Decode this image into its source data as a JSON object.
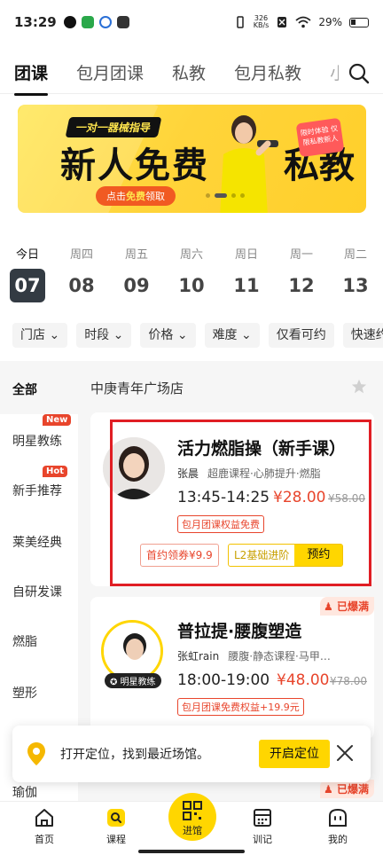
{
  "status": {
    "time": "13:29",
    "speed_top": "326",
    "speed_unit": "KB/s",
    "battery": "29%"
  },
  "tabs": [
    {
      "label": "团课"
    },
    {
      "label": "包月团课"
    },
    {
      "label": "私教"
    },
    {
      "label": "包月私教"
    },
    {
      "label": "小"
    }
  ],
  "banner": {
    "tag": "一对一器械指导",
    "headline_a": "新人免费",
    "headline_b": "私教",
    "cta_prefix": "点击",
    "cta_em": "免费",
    "cta_suffix": "领取",
    "badge": "限时体验 仅限私教新人"
  },
  "days": [
    {
      "name": "今日",
      "num": "07"
    },
    {
      "name": "周四",
      "num": "08"
    },
    {
      "name": "周五",
      "num": "09"
    },
    {
      "name": "周六",
      "num": "10"
    },
    {
      "name": "周日",
      "num": "11"
    },
    {
      "name": "周一",
      "num": "12"
    },
    {
      "name": "周二",
      "num": "13"
    }
  ],
  "filters": [
    "门店",
    "时段",
    "价格",
    "难度",
    "仅看可约",
    "快速约"
  ],
  "sidebar": [
    {
      "label": "全部"
    },
    {
      "label": "明星教练",
      "badge": "New"
    },
    {
      "label": "新手推荐",
      "badge": "Hot"
    },
    {
      "label": "莱美经典"
    },
    {
      "label": "自研发课"
    },
    {
      "label": "燃脂"
    },
    {
      "label": "塑形"
    },
    {
      "label": "瑜伽"
    }
  ],
  "store_name": "中庚青年广场店",
  "courses": [
    {
      "title": "活力燃脂操（新手课）",
      "coach": "张晨",
      "tags": "超鹿课程·心肺提升·燃脂",
      "time": "13:45-14:25",
      "price": "¥28.00",
      "orig_price": "¥58.00",
      "perk": "包月团课权益免费",
      "coupon": "首约领券¥9.9",
      "level": "L2基础进阶",
      "book": "预约"
    },
    {
      "title": "普拉提·腰腹塑造",
      "coach": "张虹rain",
      "tags": "腰腹·静态课程·马甲…",
      "time": "18:00-19:00",
      "price": "¥48.00",
      "orig_price": "¥78.00",
      "perk": "包月团课免费权益+19.9元",
      "full": "已爆满",
      "star_badge": "明星教练"
    }
  ],
  "next_full": "已爆满",
  "toast": {
    "message": "打开定位，找到最近场馆。",
    "button": "开启定位"
  },
  "nav": [
    {
      "label": "首页"
    },
    {
      "label": "课程"
    },
    {
      "label": "进馆"
    },
    {
      "label": "训记"
    },
    {
      "label": "我的"
    }
  ],
  "colors": {
    "accent": "#ffd600",
    "price": "#e8452c",
    "highlight": "#e01e24"
  }
}
